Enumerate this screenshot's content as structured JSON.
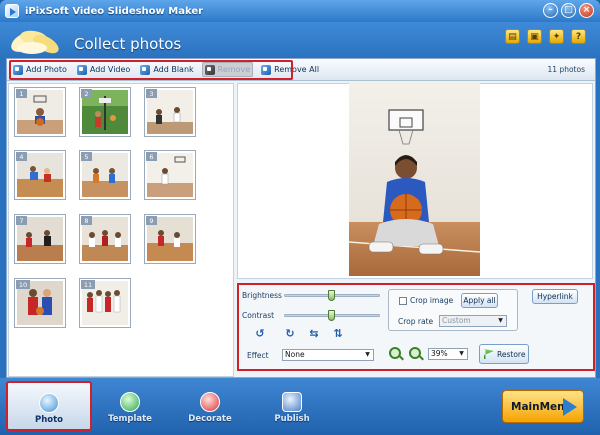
{
  "window": {
    "title": "iPixSoft Video Slideshow Maker"
  },
  "header": {
    "page_title": "Collect photos"
  },
  "toolbar": {
    "items": [
      {
        "label": "Add Photo"
      },
      {
        "label": "Add Video"
      },
      {
        "label": "Add Blank"
      },
      {
        "label": "Remove"
      },
      {
        "label": "Remove All"
      }
    ],
    "photo_count": "11 photos"
  },
  "thumbnails": [
    {
      "number": "1"
    },
    {
      "number": "2"
    },
    {
      "number": "3"
    },
    {
      "number": "4"
    },
    {
      "number": "5"
    },
    {
      "number": "6"
    },
    {
      "number": "7"
    },
    {
      "number": "8"
    },
    {
      "number": "9"
    },
    {
      "number": "10"
    },
    {
      "number": "11"
    }
  ],
  "controls": {
    "brightness_label": "Brightness",
    "brightness_value": 0.5,
    "contrast_label": "Contrast",
    "contrast_value": 0.5,
    "crop_label": "Crop image",
    "apply_all_label": "Apply all",
    "crop_rate_label": "Crop rate",
    "crop_rate_value": "Custom",
    "effect_label": "Effect",
    "effect_value": "None",
    "zoom_value": "39%",
    "restore_label": "Restore",
    "hyperlink_label": "Hyperlink"
  },
  "nav": {
    "tabs": [
      {
        "label": "Photo"
      },
      {
        "label": "Template"
      },
      {
        "label": "Decorate"
      },
      {
        "label": "Publish"
      }
    ],
    "main_menu_label": "MainMenu"
  }
}
